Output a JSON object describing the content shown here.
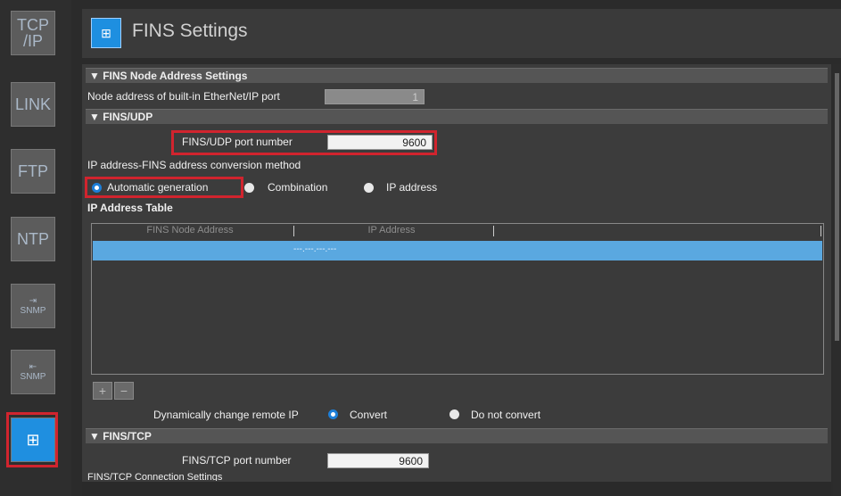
{
  "rail": {
    "items": [
      {
        "label": "TCP\n/IP"
      },
      {
        "label": "LINK"
      },
      {
        "label": "FTP"
      },
      {
        "label": "NTP"
      },
      {
        "label": "SNMP"
      },
      {
        "label": "SNMP"
      },
      {
        "label": "FINS"
      }
    ]
  },
  "header": {
    "title": "FINS Settings",
    "icon": "fins-icon"
  },
  "node": {
    "section": "▼ FINS Node Address Settings",
    "label": "Node address of built-in EtherNet/IP port",
    "value": "1"
  },
  "udp": {
    "section": "▼ FINS/UDP",
    "port_label": "FINS/UDP port number",
    "port_value": "9600",
    "method_label": "IP address-FINS address conversion method",
    "options": [
      "Automatic generation",
      "Combination",
      "IP address"
    ],
    "selected_option": "Automatic generation",
    "table_title": "IP Address Table",
    "table": {
      "columns": [
        "FINS Node Address",
        "IP Address"
      ],
      "rows": [
        {
          "node": "",
          "ip": "---.---.---.---"
        }
      ]
    },
    "add_button": "+",
    "remove_button": "−",
    "dyn_label": "Dynamically change remote IP",
    "dyn_options": [
      "Convert",
      "Do not convert"
    ],
    "dyn_selected": "Convert"
  },
  "tcp": {
    "section": "▼ FINS/TCP",
    "port_label": "FINS/TCP port number",
    "port_value": "9600",
    "conn_label": "FINS/TCP Connection Settings"
  },
  "colors": {
    "accent": "#1d7fd8",
    "highlight": "#d1242e",
    "selected_row": "#5aa8e0"
  }
}
